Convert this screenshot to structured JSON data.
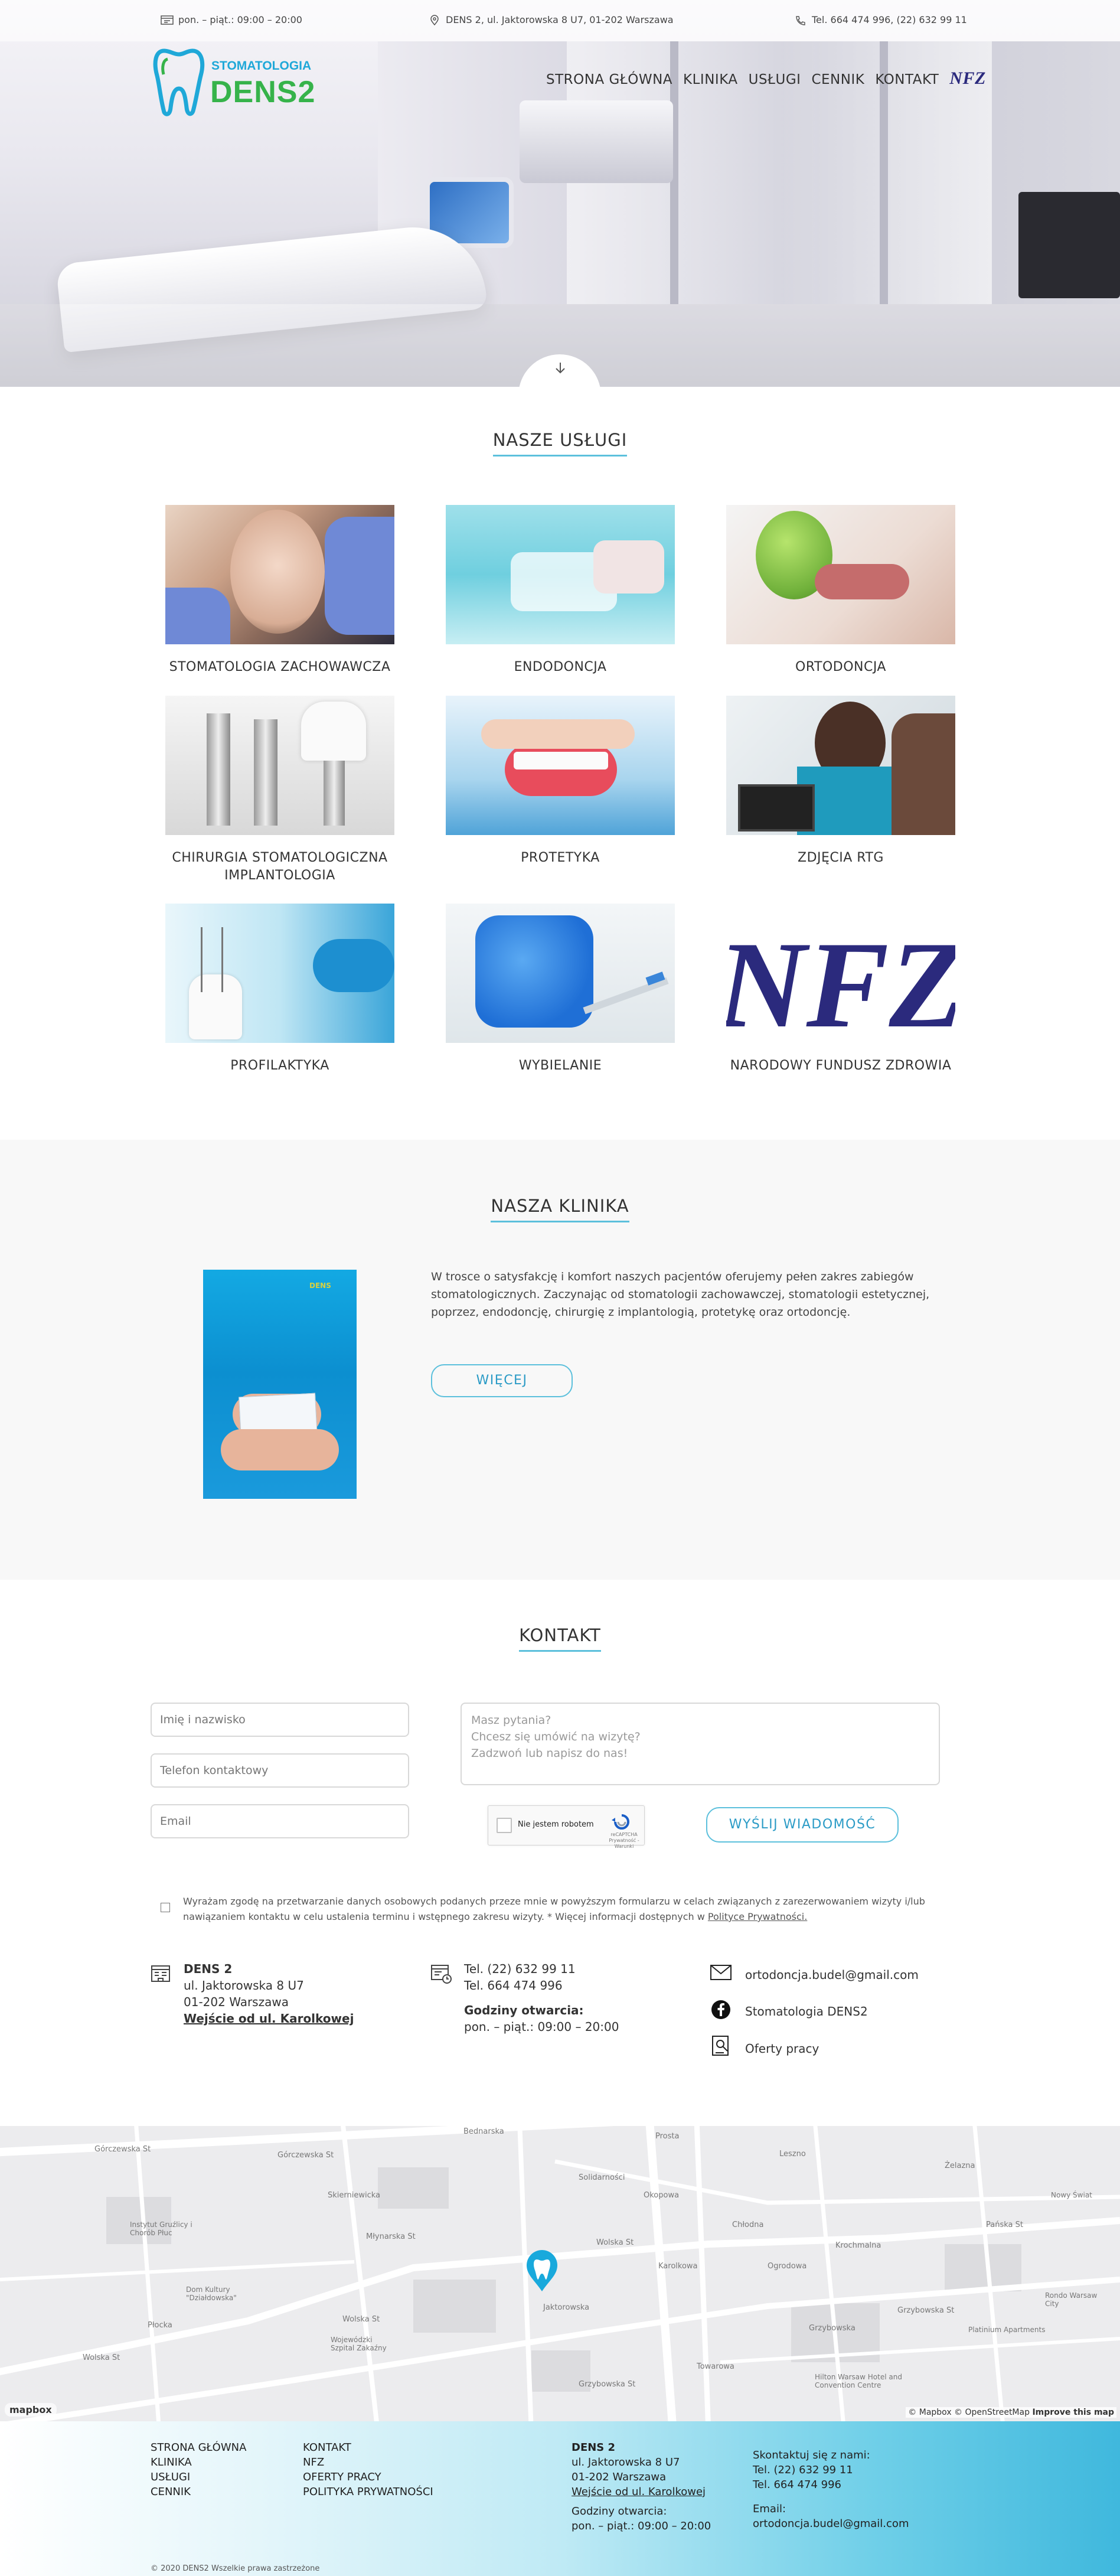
{
  "topbar": {
    "hours": "pon. – piąt.: 09:00 – 20:00",
    "address": "DENS 2, ul. Jaktorowska 8 U7, 01-202 Warszawa",
    "phones": "Tel. 664 474 996, (22) 632 99 11"
  },
  "logo": {
    "line1": "STOMATOLOGIA",
    "line2": "DENS2"
  },
  "nav": [
    "STRONA GŁÓWNA",
    "KLINIKA",
    "USŁUGI",
    "CENNIK",
    "KONTAKT",
    "NFZ"
  ],
  "services": {
    "title": "NASZE USŁUGI",
    "items": [
      "STOMATOLOGIA ZACHOWAWCZA",
      "ENDODONCJA",
      "ORTODONCJA",
      "CHIRURGIA STOMATOLOGICZNA IMPLANTOLOGIA",
      "PROTETYKA",
      "ZDJĘCIA RTG",
      "PROFILAKTYKA",
      "WYBIELANIE",
      "NARODOWY FUNDUSZ ZDROWIA"
    ],
    "nfz_logo": "NFZ"
  },
  "clinic": {
    "title": "NASZA KLINIKA",
    "text": "W trosce o satysfakcję i komfort naszych pacjentów oferujemy pełen zakres zabiegów stomatologicznych. Zaczynając od stomatologii zachowawczej, stomatologii estetycznej, poprzez, endodoncję, chirurgię z implantologią, protetykę oraz ortodoncję.",
    "button": "WIĘCEJ",
    "shirt_logo": "DENS"
  },
  "contact": {
    "title": "KONTAKT",
    "name_placeholder": "Imię i nazwisko",
    "phone_placeholder": "Telefon kontaktowy",
    "email_placeholder": "Email",
    "message_placeholder": "Masz pytania?\nChcesz się umówić na wizytę?\nZadzwoń lub napisz do nas!",
    "captcha_label": "Nie jestem robotem",
    "captcha_small": "reCAPTCHA\nPrywatność - Warunki",
    "send_button": "WYŚLIJ WIADOMOŚĆ",
    "consent_text": "Wyrażam zgodę na przetwarzanie danych osobowych podanych przeze mnie w powyższym formularzu w celach związanych z zarezerwowaniem wizyty i/lub nawiązaniem kontaktu w celu ustalenia terminu i wstępnego zakresu wizyty. * Więcej informacji dostępnych w",
    "consent_link": "Polityce Prywatności.",
    "address": {
      "name": "DENS 2",
      "street": "ul. Jaktorowska 8 U7",
      "city": "01-202 Warszawa",
      "entrance": "Wejście od ul. Karolkowej"
    },
    "phones": {
      "phone1": "Tel. (22) 632 99 11",
      "phone2": "Tel. 664 474 996",
      "hours_label": "Godziny otwarcia:",
      "hours": "pon. – piąt.: 09:00 – 20:00"
    },
    "links": {
      "email": "ortodoncja.budel@gmail.com",
      "facebook": "Stomatologia DENS2",
      "jobs": "Oferty pracy"
    }
  },
  "map": {
    "streets": [
      "Górczewska St",
      "Górczewska St",
      "Bednarska",
      "Wolska St",
      "Wolska St",
      "Wolska St",
      "Jaktorowska",
      "Grzybowska St",
      "Grzybowska St",
      "Grzybowska",
      "Prosta",
      "Okopowa",
      "Chłodna",
      "Krochmalna",
      "Pańska St",
      "Karolkowa",
      "Skierniewicka",
      "Młynarska St",
      "Płocka",
      "Towarowa",
      "Leszno",
      "Ogrodowa",
      "Solidarności",
      "Żelazna"
    ],
    "places": [
      "Instytut Gruźlicy i Chorób Płuc",
      "Dom Kultury \"Działdowska\"",
      "Wojewódzki Szpital Zakaźny",
      "Hilton Warsaw Hotel and Convention Centre",
      "Platinium Apartments",
      "Rondo Warsaw City",
      "Nowy Świat"
    ],
    "attribution": "© Mapbox © OpenStreetMap",
    "improve": "Improve this map",
    "logo": "mapbox"
  },
  "footer": {
    "col1": [
      "STRONA GŁÓWNA",
      "KLINIKA",
      "USŁUGI",
      "CENNIK"
    ],
    "col2": [
      "KONTAKT",
      "NFZ",
      "OFERTY PRACY",
      "POLITYKA PRYWATNOŚCI"
    ],
    "addr_name": "DENS 2",
    "addr_street": "ul. Jaktorowska 8 U7",
    "addr_city": "01-202 Warszawa",
    "addr_entrance": "Wejście od ul. Karolkowej",
    "hours_label": "Godziny otwarcia:",
    "hours": "pon. – piąt.: 09:00 – 20:00",
    "contact_label": "Skontaktuj się z nami:",
    "phone1": "Tel. (22) 632 99 11",
    "phone2": "Tel. 664 474 996",
    "email_label": "Email:",
    "email": "ortodoncja.budel@gmail.com",
    "copyright": "© 2020 DENS2 Wszelkie prawa zastrzeżone"
  },
  "colors": {
    "accent": "#5cc0dc",
    "brand_green": "#36b34a",
    "brand_blue": "#1fa8d8",
    "nfz": "#2b2a7d"
  }
}
